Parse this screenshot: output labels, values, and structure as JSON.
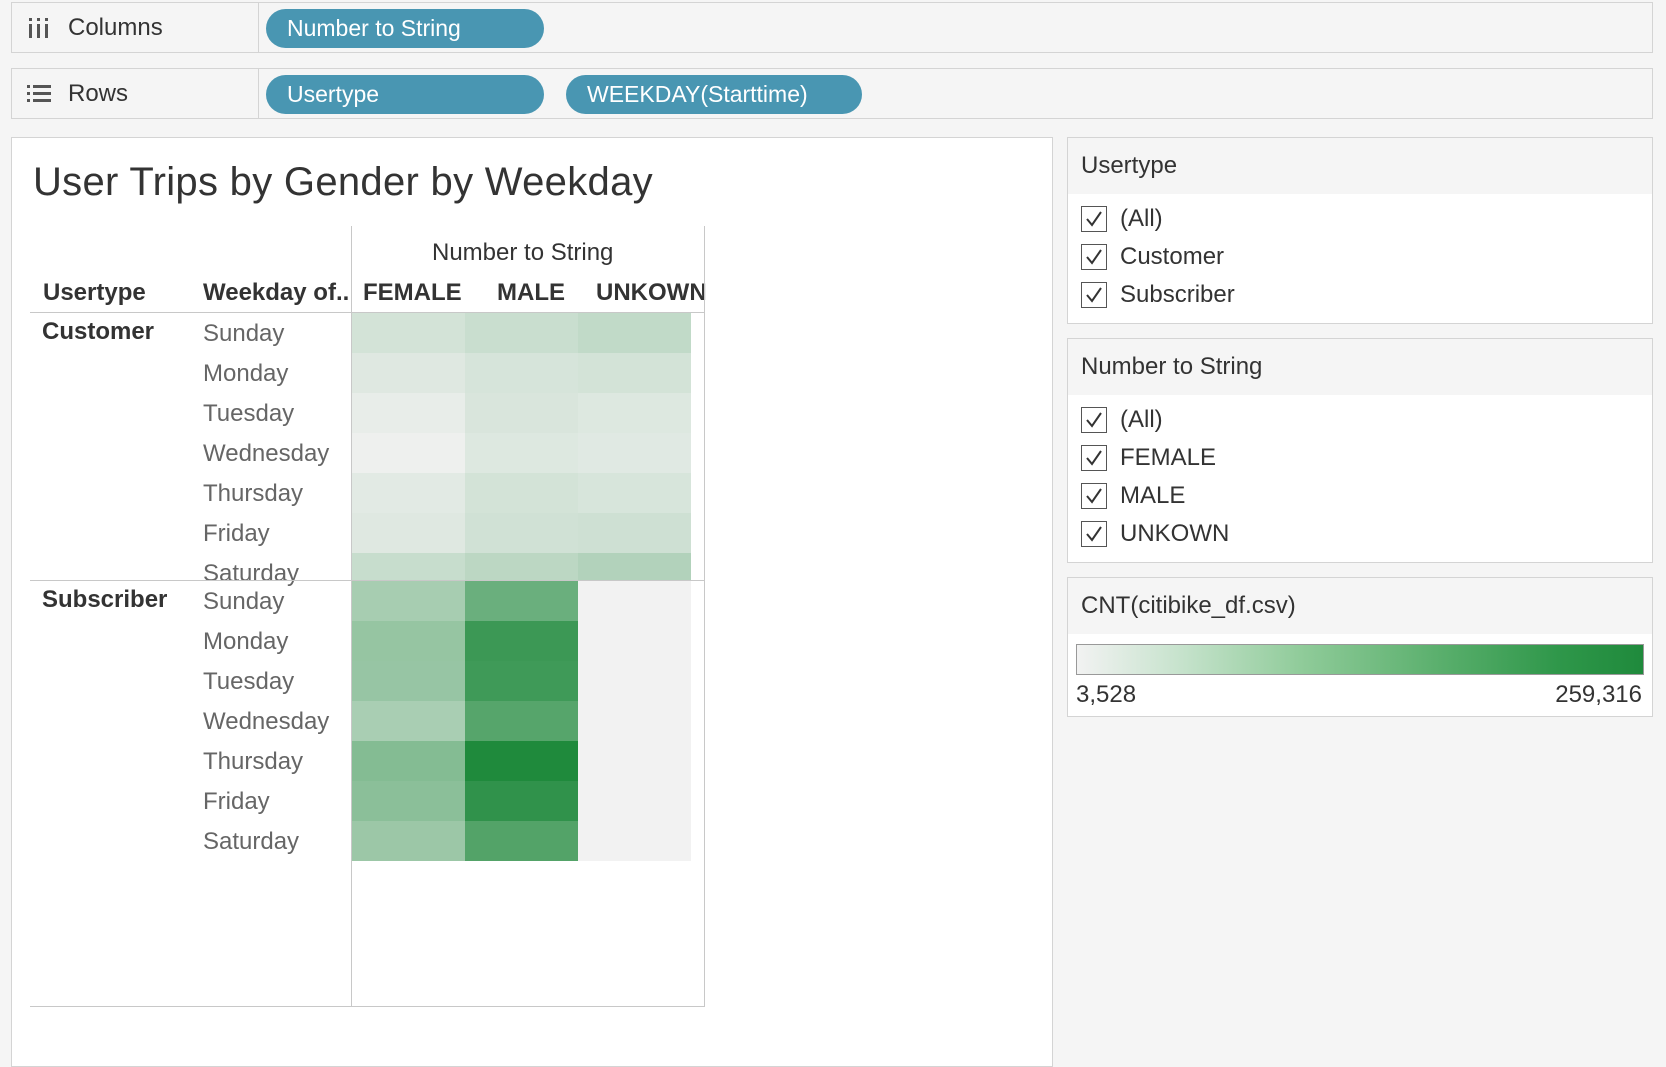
{
  "shelves": {
    "columns": {
      "label": "Columns",
      "icon": "columns-icon",
      "pills": [
        "Number to String"
      ]
    },
    "rows": {
      "label": "Rows",
      "icon": "rows-icon",
      "pills": [
        "Usertype",
        "WEEKDAY(Starttime)"
      ]
    }
  },
  "view": {
    "title": "User Trips by Gender by Weekday",
    "column_group_header": "Number to String",
    "row_headers": [
      "Usertype",
      "Weekday of.."
    ],
    "columns": [
      "FEMALE",
      "MALE",
      "UNKOWN"
    ],
    "groups": [
      {
        "name": "Customer",
        "days": [
          "Sunday",
          "Monday",
          "Tuesday",
          "Wednesday",
          "Thursday",
          "Friday",
          "Saturday"
        ]
      },
      {
        "name": "Subscriber",
        "days": [
          "Sunday",
          "Monday",
          "Tuesday",
          "Wednesday",
          "Thursday",
          "Friday",
          "Saturday"
        ]
      }
    ]
  },
  "chart_data": {
    "type": "heatmap",
    "title": "User Trips by Gender by Weekday",
    "color_measure": "CNT(citibike_df.csv)",
    "color_range": [
      3528,
      259316
    ],
    "color_low": "#f2f2f2",
    "color_high": "#1f8a3c",
    "x_categories": [
      "FEMALE",
      "MALE",
      "UNKOWN"
    ],
    "y_categories": [
      "Customer / Sunday",
      "Customer / Monday",
      "Customer / Tuesday",
      "Customer / Wednesday",
      "Customer / Thursday",
      "Customer / Friday",
      "Customer / Saturday",
      "Subscriber / Sunday",
      "Subscriber / Monday",
      "Subscriber / Tuesday",
      "Subscriber / Wednesday",
      "Subscriber / Thursday",
      "Subscriber / Friday",
      "Subscriber / Saturday"
    ],
    "values": [
      [
        20000,
        28000,
        35000
      ],
      [
        12000,
        18000,
        20000
      ],
      [
        7000,
        16000,
        13000
      ],
      [
        4500,
        13000,
        11000
      ],
      [
        10000,
        20000,
        17000
      ],
      [
        12000,
        22000,
        24000
      ],
      [
        30000,
        40000,
        50000
      ],
      [
        62000,
        140000,
        3528
      ],
      [
        82000,
        210000,
        3528
      ],
      [
        80000,
        205000,
        3528
      ],
      [
        60000,
        170000,
        3528
      ],
      [
        105000,
        259316,
        3528
      ],
      [
        95000,
        230000,
        3528
      ],
      [
        75000,
        175000,
        3528
      ]
    ]
  },
  "filters": [
    {
      "title": "Usertype",
      "items": [
        "(All)",
        "Customer",
        "Subscriber"
      ]
    },
    {
      "title": "Number to String",
      "items": [
        "(All)",
        "FEMALE",
        "MALE",
        "UNKOWN"
      ]
    }
  ],
  "legend": {
    "title": "CNT(citibike_df.csv)",
    "min_label": "3,528",
    "max_label": "259,316"
  }
}
